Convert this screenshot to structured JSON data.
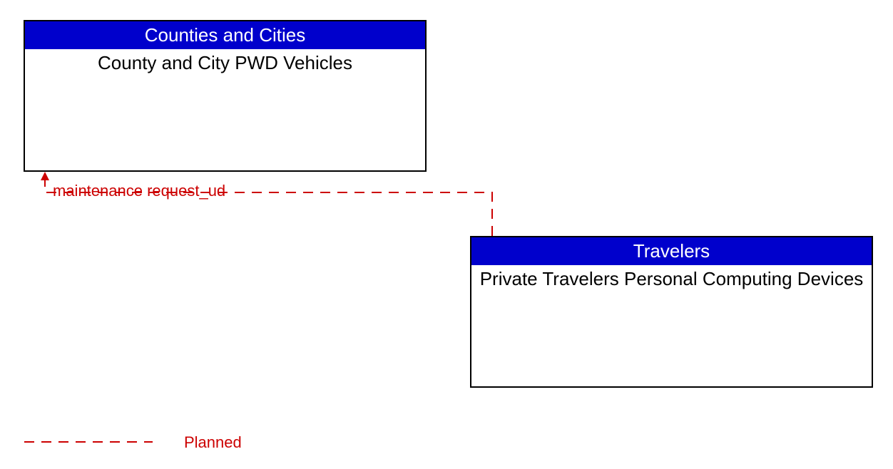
{
  "boxes": {
    "top": {
      "header": "Counties and Cities",
      "body": "County and City PWD Vehicles"
    },
    "bottom": {
      "header": "Travelers",
      "body": "Private Travelers Personal Computing Devices"
    }
  },
  "flow": {
    "label": "maintenance request_ud"
  },
  "legend": {
    "label": "Planned"
  },
  "colors": {
    "header_bg": "#0000cc",
    "line": "#cc0000"
  }
}
